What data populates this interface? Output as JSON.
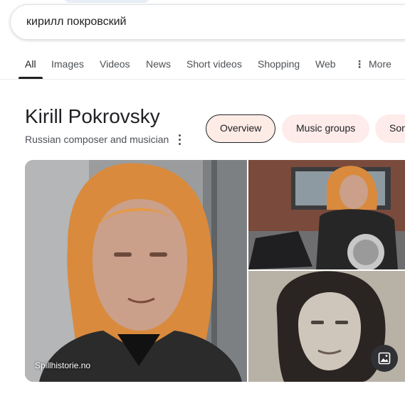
{
  "search": {
    "query": "кирилл покровский"
  },
  "tabs": [
    {
      "label": "All",
      "active": true
    },
    {
      "label": "Images"
    },
    {
      "label": "Videos"
    },
    {
      "label": "News"
    },
    {
      "label": "Short videos"
    },
    {
      "label": "Shopping"
    },
    {
      "label": "Web"
    },
    {
      "label": "More",
      "icon": "vertical-dots-icon"
    }
  ],
  "knowledge_panel": {
    "title": "Kirill Pokrovsky",
    "subtitle": "Russian composer and musician",
    "menu_icon": "vertical-dots-icon",
    "chips": [
      {
        "label": "Overview",
        "active": true
      },
      {
        "label": "Music groups"
      },
      {
        "label": "Son"
      }
    ]
  },
  "images": {
    "source_label": "Spillhistorie.no",
    "view_images_icon": "image-icon"
  },
  "colors": {
    "chip_bg": "#fdecea",
    "tab_active_underline": "#202124",
    "hair": "#d98a3d"
  }
}
